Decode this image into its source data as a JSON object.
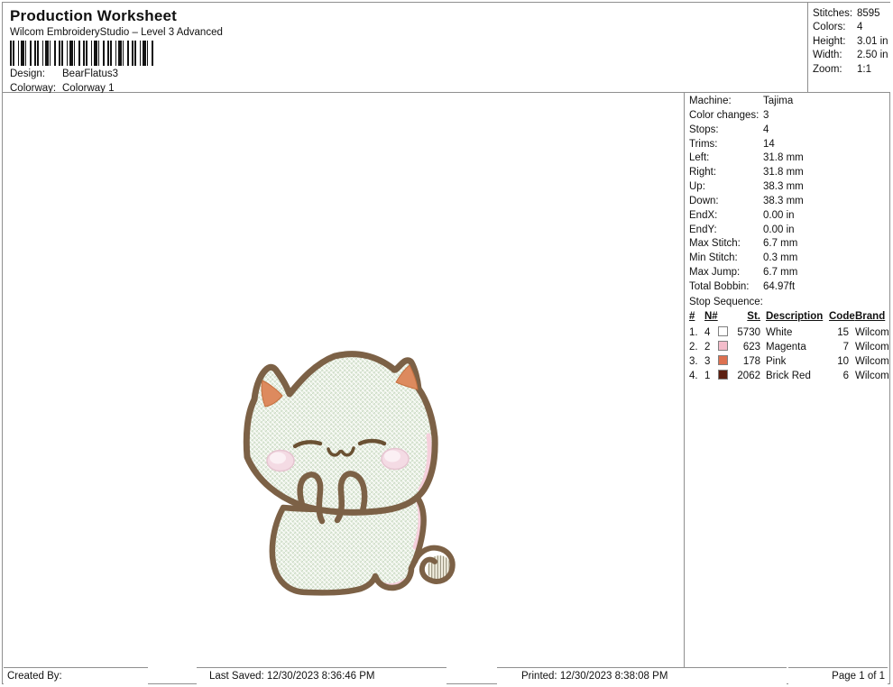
{
  "header": {
    "title": "Production Worksheet",
    "subtitle": "Wilcom EmbroideryStudio – Level 3 Advanced",
    "design_label": "Design:",
    "design_value": "BearFlatus3",
    "colorway_label": "Colorway:",
    "colorway_value": "Colorway 1"
  },
  "stats": {
    "rows": [
      {
        "label": "Stitches:",
        "value": "8595"
      },
      {
        "label": "Colors:",
        "value": "4"
      },
      {
        "label": "Height:",
        "value": "3.01 in"
      },
      {
        "label": "Width:",
        "value": "2.50 in"
      },
      {
        "label": "Zoom:",
        "value": "1:1"
      }
    ]
  },
  "machine": {
    "rows": [
      {
        "label": "Machine:",
        "value": "Tajima"
      },
      {
        "label": "Color changes:",
        "value": "3"
      },
      {
        "label": "Stops:",
        "value": "4"
      },
      {
        "label": "Trims:",
        "value": "14"
      },
      {
        "label": "Left:",
        "value": "31.8 mm"
      },
      {
        "label": "Right:",
        "value": "31.8 mm"
      },
      {
        "label": "Up:",
        "value": "38.3 mm"
      },
      {
        "label": "Down:",
        "value": "38.3 mm"
      },
      {
        "label": "EndX:",
        "value": "0.00 in"
      },
      {
        "label": "EndY:",
        "value": "0.00 in"
      },
      {
        "label": "Max Stitch:",
        "value": "6.7 mm"
      },
      {
        "label": "Min Stitch:",
        "value": "0.3 mm"
      },
      {
        "label": "Max Jump:",
        "value": "6.7 mm"
      },
      {
        "label": "Total Bobbin:",
        "value": "64.97ft"
      }
    ]
  },
  "stop_sequence": {
    "title": "Stop Sequence:",
    "columns": [
      "#",
      "N#",
      "St.",
      "Description",
      "Code",
      "Brand"
    ],
    "rows": [
      {
        "num": "1.",
        "n": "4",
        "swatch": "#ffffff",
        "st": "5730",
        "description": "White",
        "code": "15",
        "brand": "Wilcom"
      },
      {
        "num": "2.",
        "n": "2",
        "swatch": "#f3bcca",
        "st": "623",
        "description": "Magenta",
        "code": "7",
        "brand": "Wilcom"
      },
      {
        "num": "3.",
        "n": "3",
        "swatch": "#dd7150",
        "st": "178",
        "description": "Pink",
        "code": "10",
        "brand": "Wilcom"
      },
      {
        "num": "4.",
        "n": "1",
        "swatch": "#5c1f11",
        "st": "2062",
        "description": "Brick Red",
        "code": "6",
        "brand": "Wilcom"
      }
    ]
  },
  "design_preview": {
    "description": "chibi cat embroidery stitch preview, paws together",
    "colors": {
      "fill": "#e9efe3",
      "weave": "#c9dac4",
      "outline": "#7c6146",
      "inner_ear": "#dd8a5e",
      "blush": "#f4dbe4",
      "accent_pink": "#f5cfdb",
      "face": "#6a5133",
      "tail_fill": "#f4f1e2"
    }
  },
  "footer": {
    "created_by": "Created By:",
    "last_saved": "Last Saved: 12/30/2023 8:36:46 PM",
    "printed": "Printed: 12/30/2023 8:38:08 PM",
    "page": "Page 1 of 1"
  }
}
